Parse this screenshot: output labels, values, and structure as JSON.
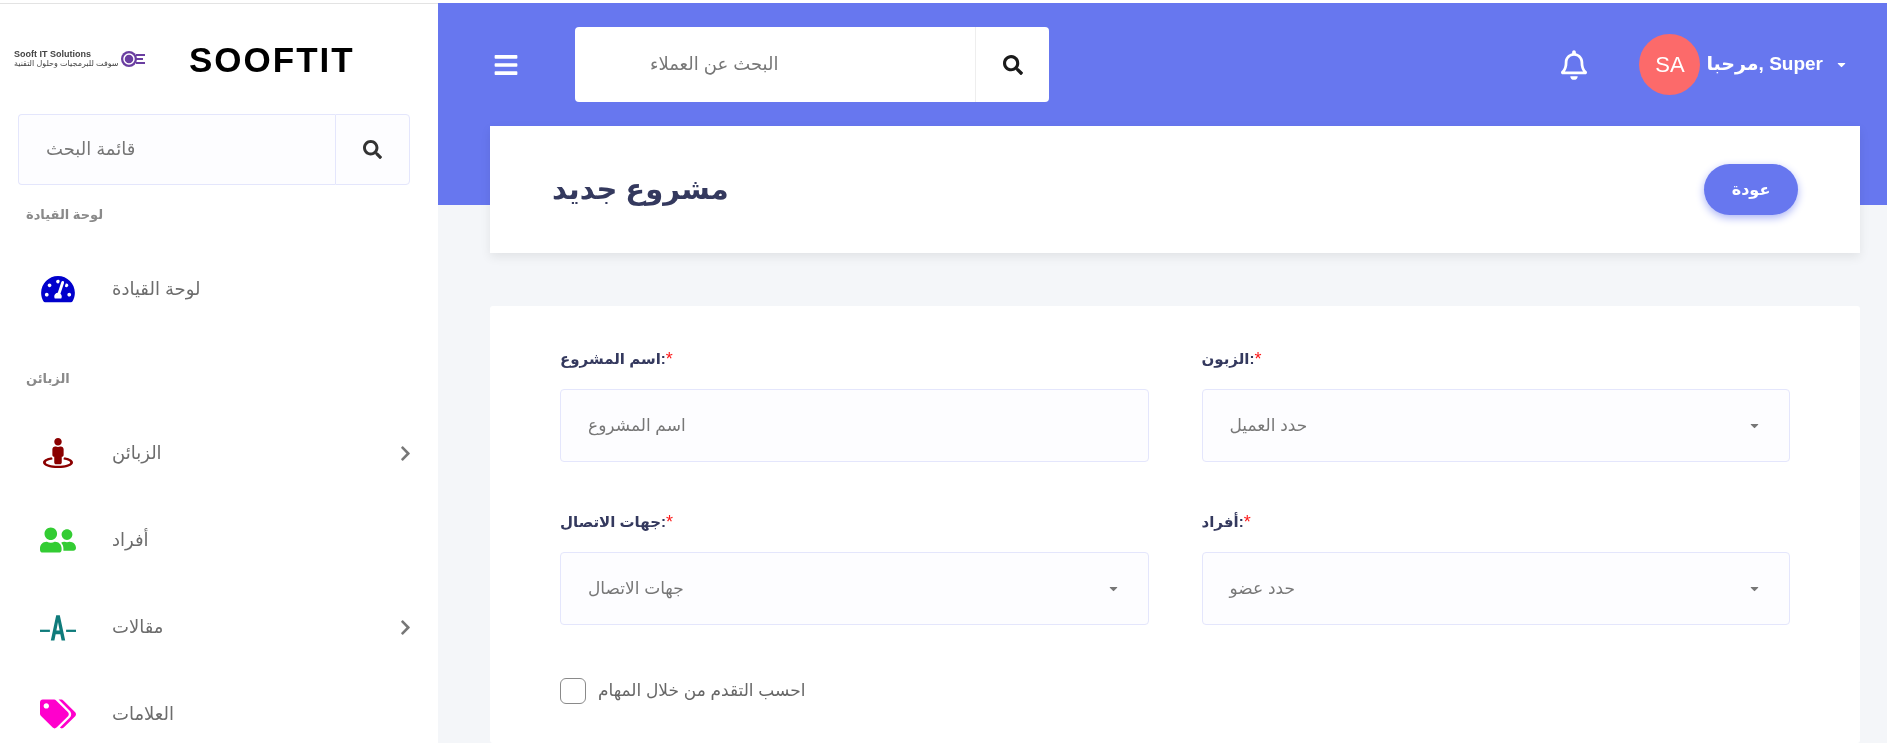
{
  "sidebar": {
    "logo": {
      "name": "Sooft IT Solutions",
      "tagline": "سوفت للبرمجيات وحلول التقنية"
    },
    "brand": "SOOFTIT",
    "search": {
      "placeholder": "قائمة البحث"
    },
    "sections": [
      {
        "heading": "لوحة القيادة",
        "items": [
          {
            "label": "لوحة القيادة",
            "kind": "link",
            "color": "#0000cc"
          }
        ]
      },
      {
        "heading": "الزبائن",
        "items": [
          {
            "label": "الزبائن",
            "kind": "submenu",
            "color": "#8b0000"
          },
          {
            "label": "أفراد",
            "kind": "link",
            "color": "#33cc33"
          },
          {
            "label": "مقالات",
            "kind": "submenu",
            "color": "#0f7b7b"
          },
          {
            "label": "العلامات",
            "kind": "link",
            "color": "#ff00cc"
          }
        ]
      }
    ]
  },
  "header": {
    "search": {
      "placeholder": "البحث عن العملاء"
    },
    "user": {
      "initials": "SA",
      "greeting": "مرحبا, Super"
    }
  },
  "page": {
    "title": "مشروع جديد",
    "back_button": "عودة"
  },
  "form": {
    "fields": [
      {
        "label": "الزبون:",
        "required_mark": "*",
        "kind": "select",
        "placeholder": "حدد العميل"
      },
      {
        "label": "اسم المشروع:",
        "required_mark": "*",
        "kind": "text",
        "placeholder": "اسم المشروع"
      },
      {
        "label": "أفراد:",
        "required_mark": "*",
        "kind": "select",
        "placeholder": "حدد عضو"
      },
      {
        "label": "جهات الاتصال:",
        "required_mark": "*",
        "kind": "select",
        "placeholder": "جهات الاتصال"
      }
    ],
    "checkbox": {
      "label": "احسب التقدم من خلال المهام",
      "checked": false
    }
  }
}
